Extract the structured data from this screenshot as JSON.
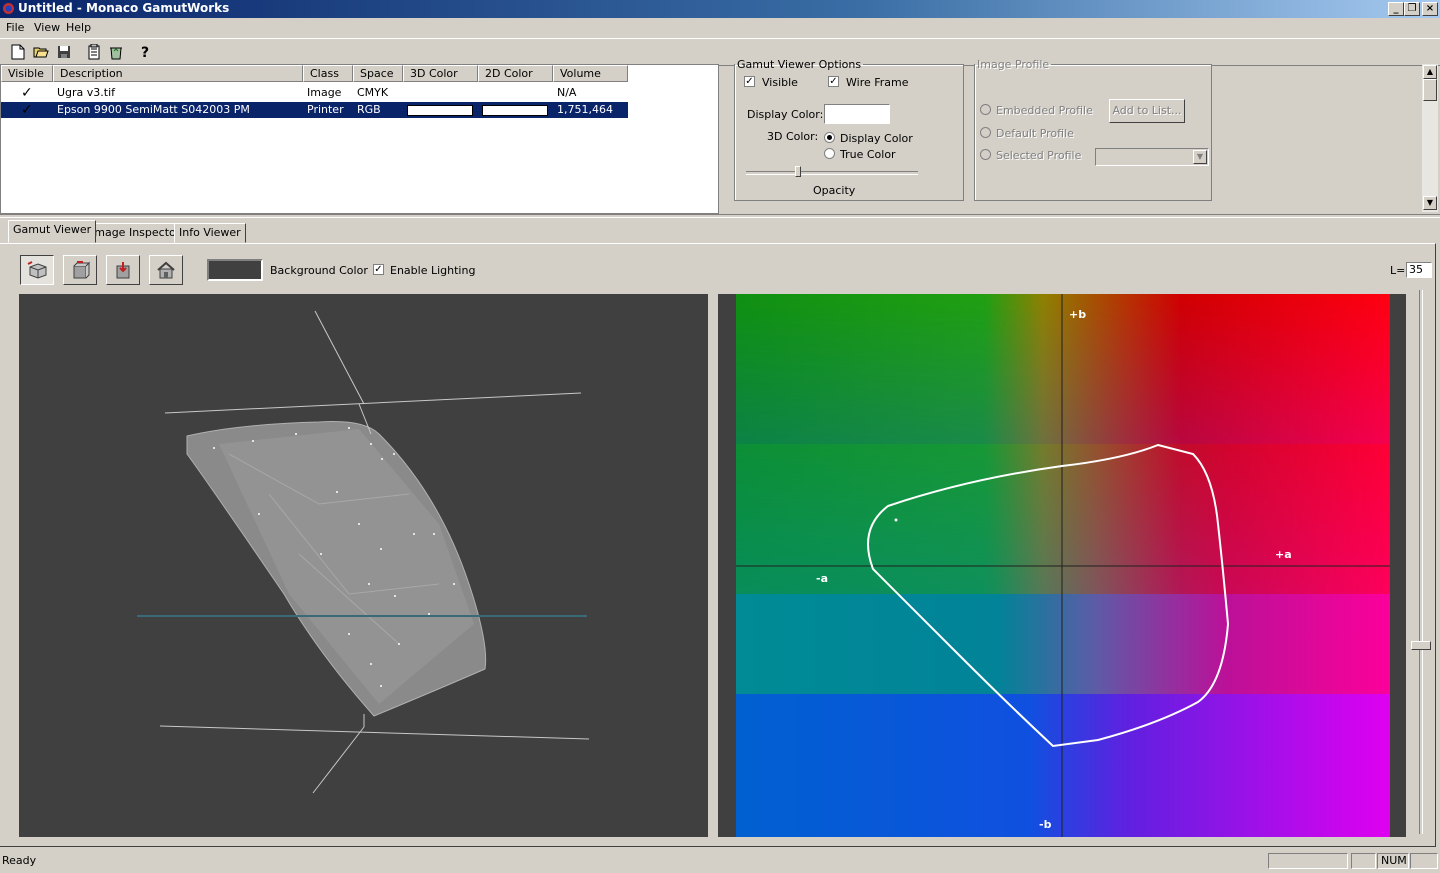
{
  "window": {
    "title": "Untitled - Monaco GamutWorks"
  },
  "menu": [
    {
      "label": "File"
    },
    {
      "label": "View"
    },
    {
      "label": "Help"
    }
  ],
  "list": {
    "headers": [
      "Visible",
      "Description",
      "Class",
      "Space",
      "3D Color",
      "2D Color",
      "Volume"
    ],
    "rows": [
      {
        "visible": "✓",
        "description": "Ugra v3.tif",
        "class": "Image",
        "space": "CMYK",
        "volume": "N/A",
        "selected": false
      },
      {
        "visible": "✓",
        "description": "Epson 9900 SemiMatt S042003 PM",
        "class": "Printer",
        "space": "RGB",
        "volume": "1,751,464",
        "selected": true
      }
    ]
  },
  "gamut_options": {
    "legend": "Gamut Viewer Options",
    "visible_label": "Visible",
    "visible_checked": true,
    "wireframe_label": "Wire Frame",
    "wireframe_checked": true,
    "display_color_label": "Display Color:",
    "color3d_label": "3D Color:",
    "radio_display_color": "Display Color",
    "radio_true_color": "True Color",
    "opacity_label": "Opacity",
    "opacity_value": 0.3
  },
  "image_profile": {
    "legend": "Image Profile",
    "embedded": "Embedded Profile",
    "add_button": "Add to List...",
    "default": "Default Profile",
    "selected": "Selected Profile"
  },
  "tabs": [
    {
      "label": "Gamut Viewer",
      "active": true
    },
    {
      "label": "Image Inspector",
      "active": false
    },
    {
      "label": "Info Viewer",
      "active": false
    }
  ],
  "gamut_toolbar": {
    "background_color_label": "Background Color",
    "background_color": "#404040",
    "enable_lighting_label": "Enable Lighting",
    "enable_lighting_checked": true,
    "l_label": "L=",
    "l_value": "35"
  },
  "plot2d": {
    "plus_b": "+b",
    "minus_b": "-b",
    "plus_a": "+a",
    "minus_a": "-a"
  },
  "status": {
    "text": "Ready",
    "num": "NUM"
  },
  "colors": {
    "selection": "#0a246a",
    "face": "#d4d0c8",
    "title_start": "#0a246a",
    "title_end": "#a6caf0"
  }
}
